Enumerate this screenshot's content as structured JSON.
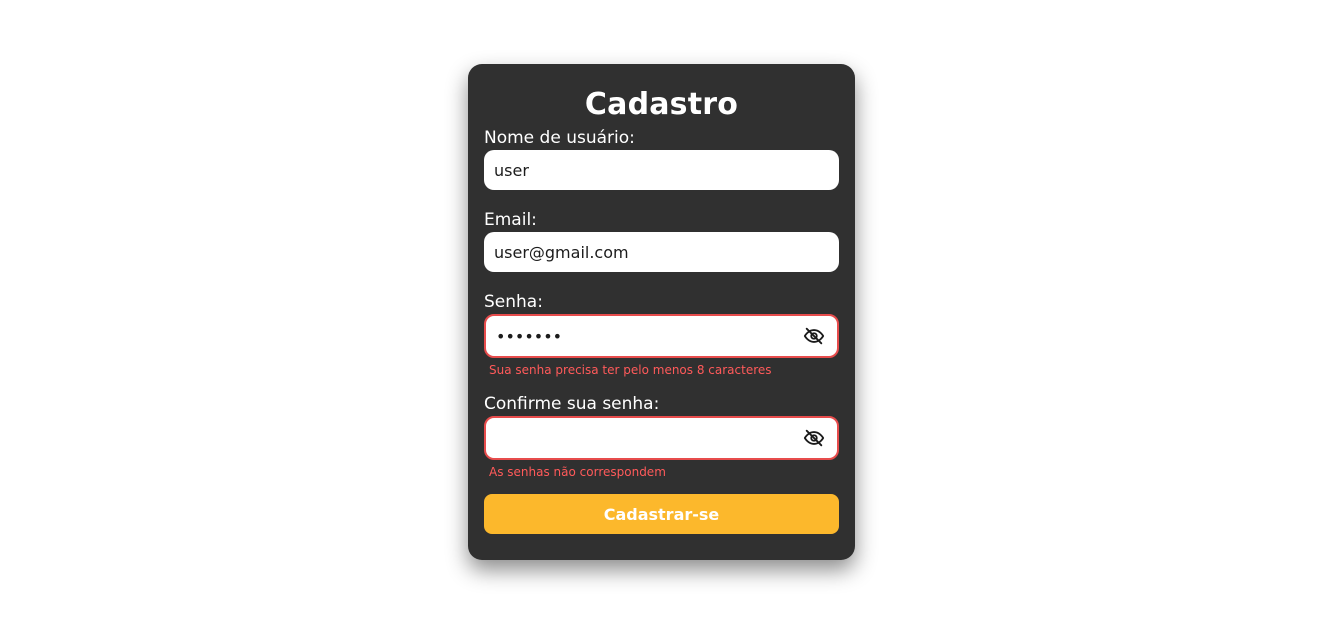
{
  "form": {
    "title": "Cadastro",
    "username": {
      "label": "Nome de usuário:",
      "value": "user"
    },
    "email": {
      "label": "Email:",
      "value": "user@gmail.com"
    },
    "password": {
      "label": "Senha:",
      "value": "1234567",
      "error": "Sua senha precisa ter pelo menos 8 caracteres",
      "toggle_icon": "eye-off-icon"
    },
    "confirm_password": {
      "label": "Confirme sua senha:",
      "value": "",
      "error": "As senhas não correspondem",
      "toggle_icon": "eye-off-icon"
    },
    "submit_label": "Cadastrar-se"
  },
  "colors": {
    "card_background": "#303030",
    "error": "#e74c4c",
    "accent": "#fcb82c"
  }
}
